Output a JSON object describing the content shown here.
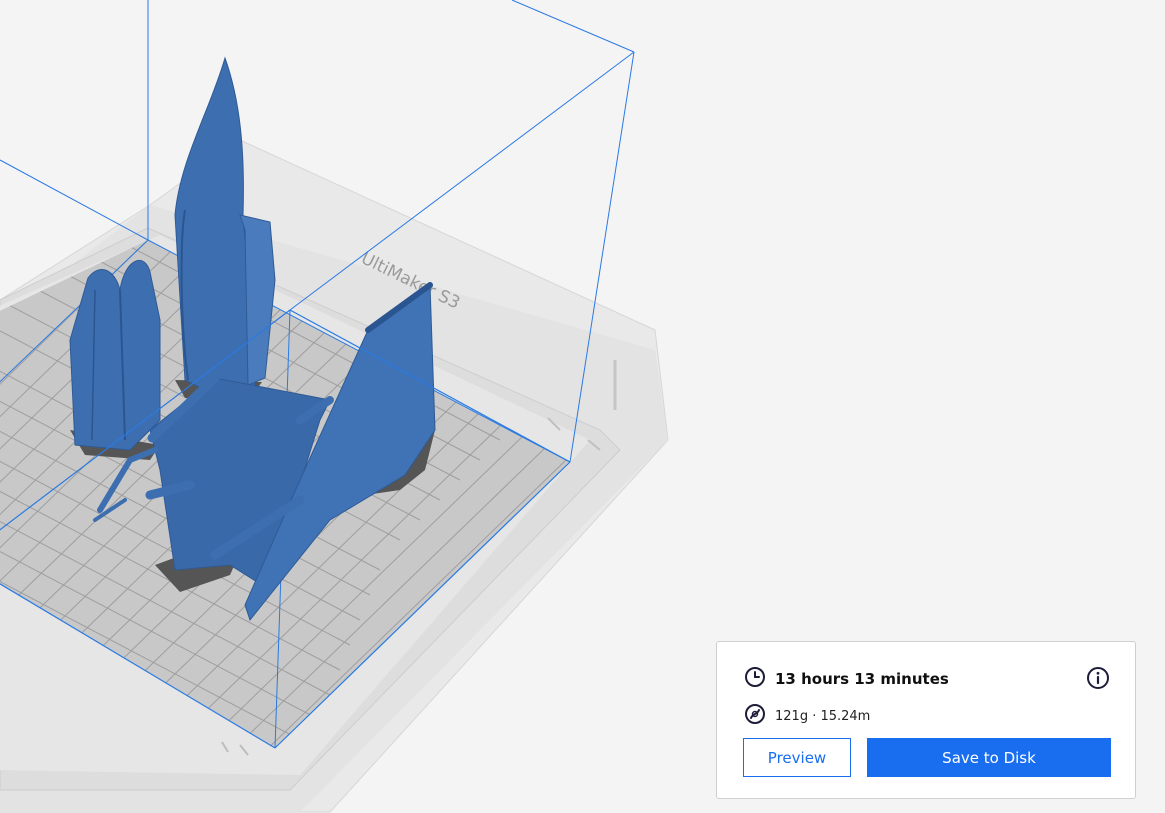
{
  "printer": {
    "label": "UltiMaker S3"
  },
  "print_summary": {
    "time_label": "13 hours 13 minutes",
    "material_label": "121g · 15.24m",
    "time_icon": "clock-icon",
    "material_icon": "spool-icon",
    "info_icon": "info-icon"
  },
  "actions": {
    "preview_label": "Preview",
    "save_label": "Save to Disk"
  },
  "colors": {
    "accent": "#196ef0",
    "model": "#3d6fb0",
    "volume_outline": "#2a7ae2",
    "background": "#f4f4f4"
  }
}
